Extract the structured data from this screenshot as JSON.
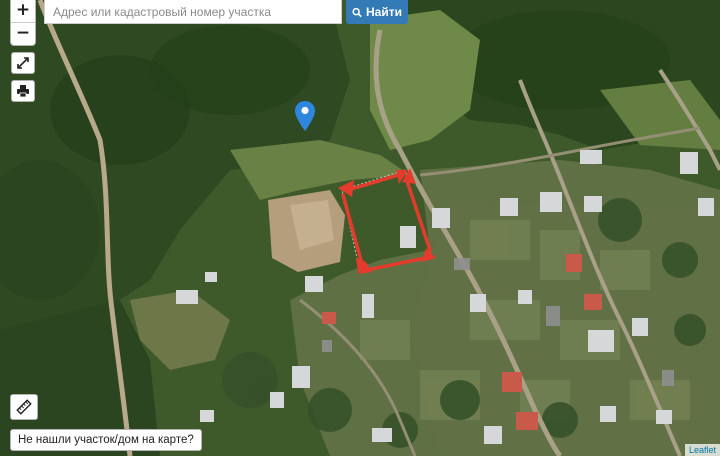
{
  "search": {
    "placeholder": "Адрес или кадастровый номер участка",
    "button_label": "Найти",
    "button_icon": "search-icon"
  },
  "zoom": {
    "in_label": "+",
    "out_label": "−"
  },
  "tools": {
    "fullscreen_icon": "expand-icon",
    "print_icon": "printer-icon",
    "ruler_icon": "ruler-icon"
  },
  "not_found_button": "Не нашли участок/дом на карте?",
  "attribution": "Leaflet",
  "colors": {
    "search_button": "#337ab7",
    "marker": "#2e86de",
    "boundary": "#e53b2c"
  }
}
